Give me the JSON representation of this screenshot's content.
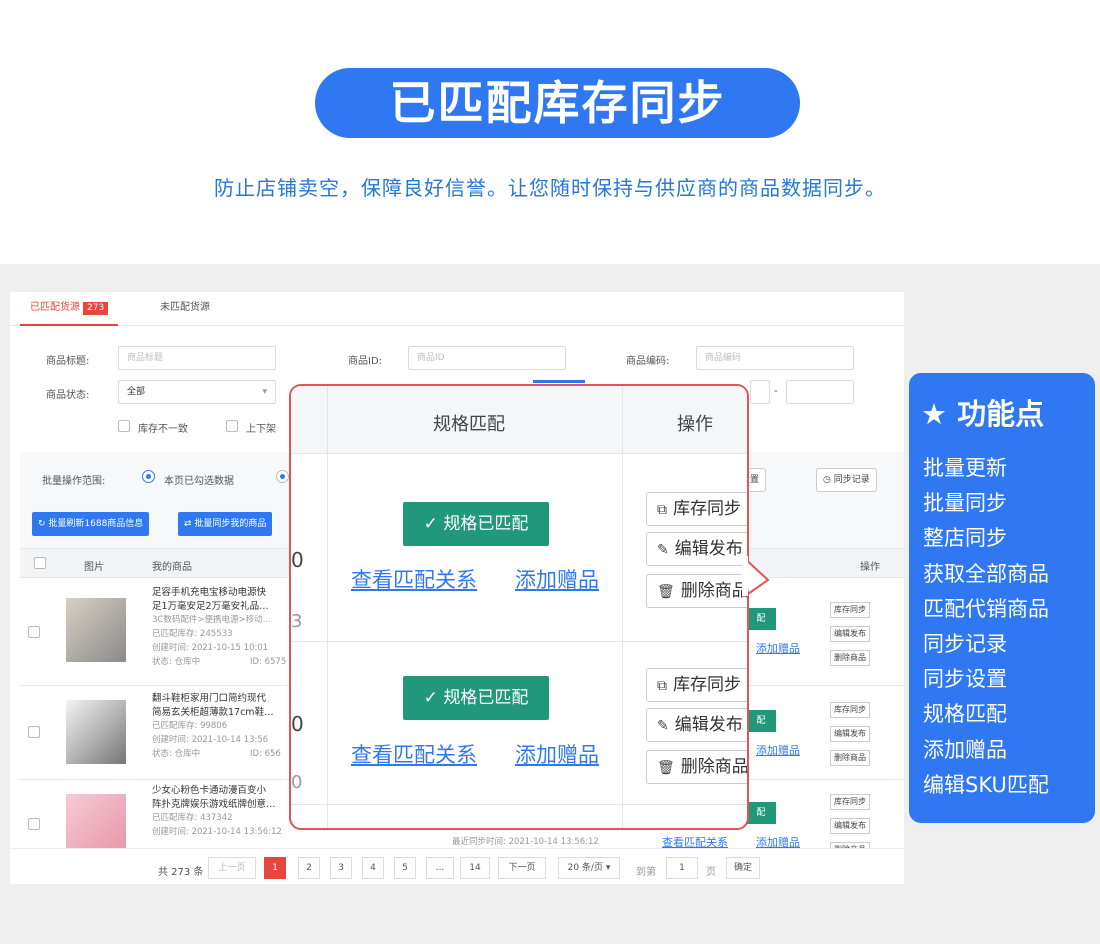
{
  "banner": {
    "title": "已匹配库存同步"
  },
  "subtitle": "防止店铺卖空，保障良好信誉。让您随时保持与供应商的商品数据同步。",
  "tabs": [
    {
      "label": "已匹配货源",
      "badge": "273"
    },
    {
      "label": "未匹配货源"
    }
  ],
  "filters": {
    "title_label": "商品标题:",
    "title_placeholder": "商品标题",
    "id_label": "商品ID:",
    "id_placeholder": "商品ID",
    "code_label": "商品编码:",
    "code_placeholder": "商品编码",
    "status_label": "商品状态:",
    "status_value": "全部",
    "range_sep": "-",
    "check_stock": "库存不一致",
    "check_shelf": "上下架"
  },
  "batch": {
    "scope_label": "批量操作范围:",
    "scope_option": "本页已勾选数据",
    "refresh_btn": "批量刷新1688商品信息",
    "sync_btn": "批量同步我的商品",
    "sync_settings": "同步设置",
    "sync_records": "同步记录"
  },
  "table": {
    "headers": {
      "image": "图片",
      "product": "我的商品",
      "ops": "操作"
    },
    "rows": [
      {
        "title1": "足容手机充电宝移动电源快",
        "title2": "足1万毫安足2万毫安礼品…",
        "cat": "3C数码配件>便携电源>移动…",
        "stock": "已匹配库存: 245533",
        "created": "创建时间: 2021-10-15 10:01",
        "status": "状态: 仓库中",
        "id": "ID: 6575"
      },
      {
        "title1": "翻斗鞋柜家用门口简约现代",
        "title2": "简易玄关柜超薄款17cm鞋…",
        "stock": "已匹配库存: 99806",
        "created": "创建时间: 2021-10-14 13:56",
        "status": "状态: 仓库中",
        "id": "ID: 656"
      },
      {
        "title1": "少女心粉色卡通动漫百变小",
        "title2": "阵扑克牌娱乐游戏纸牌创意…",
        "stock": "已匹配库存: 437342",
        "created": "创建时间: 2021-10-14 13:56:12",
        "last_sync": "最近同步时间: 2021-10-14 13:56:12"
      }
    ],
    "small_ops": [
      "库存同步",
      "编辑发布",
      "删除商品"
    ],
    "view_match": "查看匹配关系",
    "add_gift": "添加赠品",
    "matched_short": "配"
  },
  "pager": {
    "total": "共 273 条",
    "prev": "上一页",
    "pages": [
      "1",
      "2",
      "3",
      "4",
      "5",
      "...",
      "14"
    ],
    "next": "下一页",
    "per_page": "20 条/页",
    "goto": "到第",
    "page_input": "1",
    "page_unit": "页",
    "confirm": "确定"
  },
  "popup": {
    "col_spec": "规格匹配",
    "col_ops": "操作",
    "matched": "规格已匹配",
    "view_match": "查看匹配关系",
    "add_gift": "添加赠品",
    "ops": [
      "库存同步",
      "编辑发布",
      "删除商品"
    ],
    "stray": [
      "0",
      "3",
      "0",
      "0"
    ]
  },
  "features": {
    "title": "功能点",
    "items": [
      "批量更新",
      "批量同步",
      "整店同步",
      "获取全部商品",
      "匹配代销商品",
      "同步记录",
      "同步设置",
      "规格匹配",
      "添加赠品",
      "编辑SKU匹配"
    ]
  },
  "colors": {
    "brand": "#2f78f2",
    "accent": "#e8453c",
    "matched": "#21987a",
    "popup_border": "#e35454",
    "subtitle": "#2577d8"
  }
}
